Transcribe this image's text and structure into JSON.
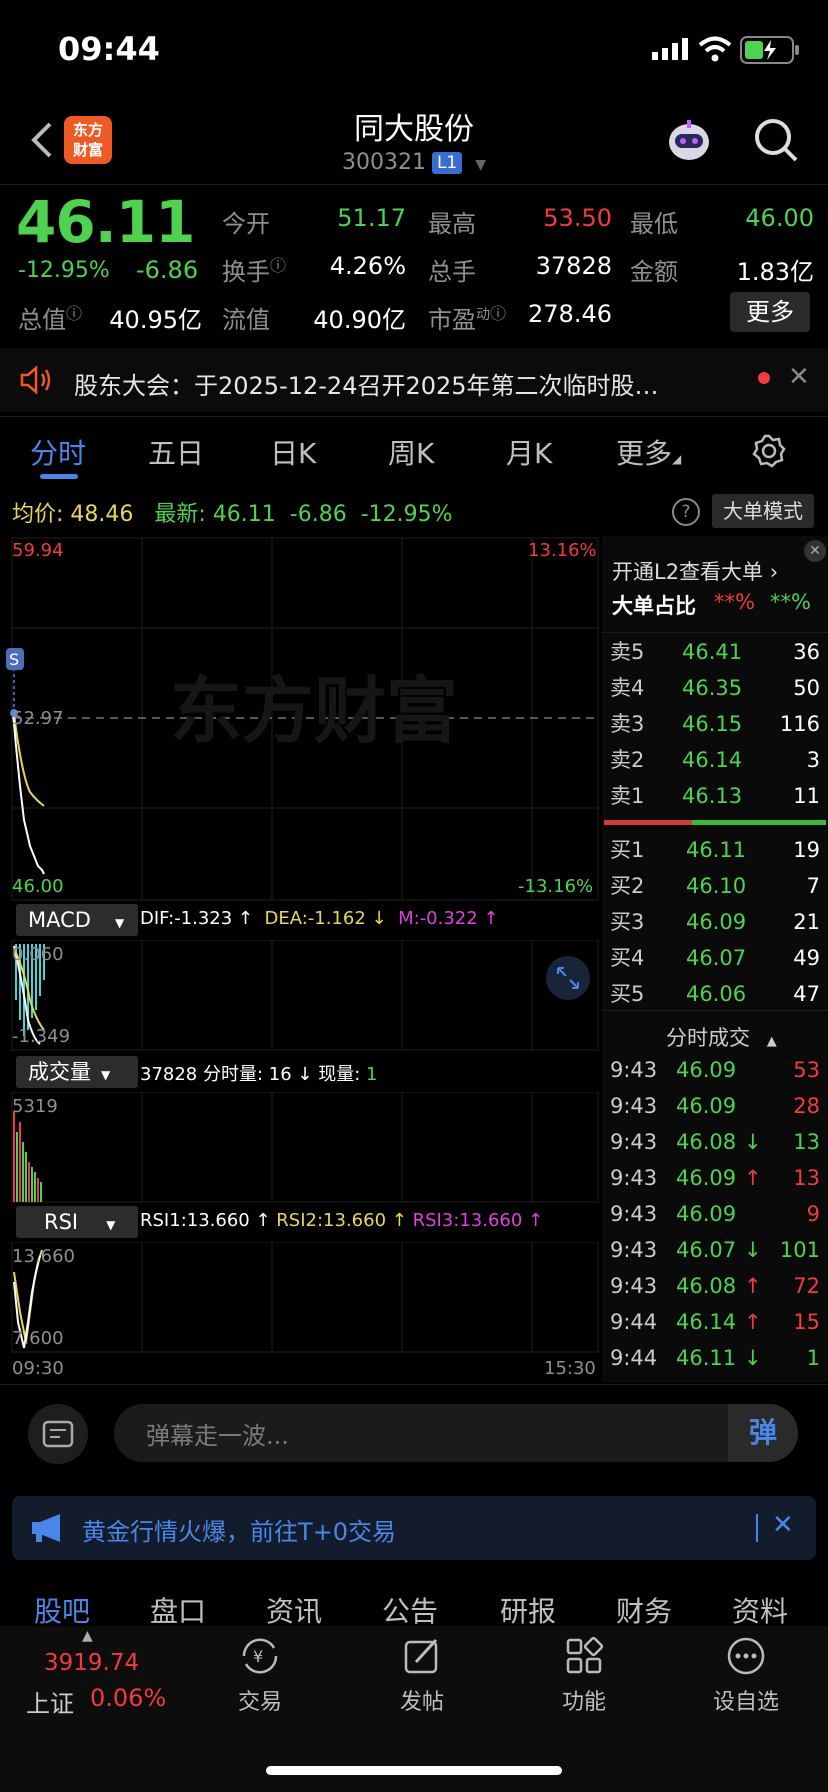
{
  "status": {
    "time": "09:44"
  },
  "header": {
    "title": "同大股份",
    "code": "300321",
    "level_badge": "L1",
    "logo_line1": "东方",
    "logo_line2": "财富"
  },
  "quote": {
    "price": "46.11",
    "change_pct": "-12.95%",
    "change": "-6.86",
    "open_label": "今开",
    "open": "51.17",
    "high_label": "最高",
    "high": "53.50",
    "low_label": "最低",
    "low": "46.00",
    "turnover_label": "换手",
    "turnover": "4.26%",
    "volume_label": "总手",
    "volume": "37828",
    "amount_label": "金额",
    "amount": "1.83亿",
    "mktcap_label": "总值",
    "mktcap": "40.95亿",
    "float_label": "流值",
    "float": "40.90亿",
    "pe_label": "市盈",
    "pe_sup": "动",
    "pe": "278.46",
    "more": "更多"
  },
  "notice": {
    "text": "股东大会：于2025-12-24召开2025年第二次临时股…"
  },
  "tabs": [
    "分时",
    "五日",
    "日K",
    "周K",
    "月K",
    "更多"
  ],
  "info_line": {
    "avg_label": "均价:",
    "avg": "48.46",
    "latest_label": "最新:",
    "latest": "46.11",
    "chg": "-6.86",
    "chg_pct": "-12.95%",
    "mode_btn": "大单模式"
  },
  "chart": {
    "y_top": "59.94",
    "y_mid": "52.97",
    "y_bot": "46.00",
    "pct_top": "13.16%",
    "pct_bot": "-13.16%",
    "watermark": "东方财富",
    "macd": {
      "label": "MACD",
      "dif": "DIF:-1.323 ↑",
      "dea": "DEA:-1.162 ↓",
      "m": "M:-0.322 ↑",
      "y_top": "0.060",
      "y_bot": "-1.349"
    },
    "vol": {
      "label": "成交量",
      "text": "37828 分时量: 16 ↓ 现量: ",
      "now": "1",
      "y_top": "5319"
    },
    "rsi": {
      "label": "RSI",
      "rsi1": "RSI1:13.660 ↑",
      "rsi2": "RSI2:13.660 ↑",
      "rsi3": "RSI3:13.660 ↑",
      "y_top": "13.660",
      "y_bot": "7.600"
    },
    "time_start": "09:30",
    "time_end": "15:30"
  },
  "panel": {
    "l2_text": "开通L2查看大单",
    "big_ratio_label": "大单占比",
    "big_red": "**%",
    "big_green": "**%",
    "asks": [
      {
        "label": "卖5",
        "price": "46.41",
        "vol": "36"
      },
      {
        "label": "卖4",
        "price": "46.35",
        "vol": "50"
      },
      {
        "label": "卖3",
        "price": "46.15",
        "vol": "116"
      },
      {
        "label": "卖2",
        "price": "46.14",
        "vol": "3"
      },
      {
        "label": "卖1",
        "price": "46.13",
        "vol": "11"
      }
    ],
    "bids": [
      {
        "label": "买1",
        "price": "46.11",
        "vol": "19"
      },
      {
        "label": "买2",
        "price": "46.10",
        "vol": "7"
      },
      {
        "label": "买3",
        "price": "46.09",
        "vol": "21"
      },
      {
        "label": "买4",
        "price": "46.07",
        "vol": "49"
      },
      {
        "label": "买5",
        "price": "46.06",
        "vol": "47"
      }
    ],
    "trades_title": "分时成交",
    "trades": [
      {
        "time": "9:43",
        "price": "46.09",
        "arrow": "",
        "vol": "53",
        "dir": "red"
      },
      {
        "time": "9:43",
        "price": "46.09",
        "arrow": "",
        "vol": "28",
        "dir": "red"
      },
      {
        "time": "9:43",
        "price": "46.08",
        "arrow": "↓",
        "vol": "13",
        "dir": "green"
      },
      {
        "time": "9:43",
        "price": "46.09",
        "arrow": "↑",
        "vol": "13",
        "dir": "red"
      },
      {
        "time": "9:43",
        "price": "46.09",
        "arrow": "",
        "vol": "9",
        "dir": "red"
      },
      {
        "time": "9:43",
        "price": "46.07",
        "arrow": "↓",
        "vol": "101",
        "dir": "green"
      },
      {
        "time": "9:43",
        "price": "46.08",
        "arrow": "↑",
        "vol": "72",
        "dir": "red"
      },
      {
        "time": "9:44",
        "price": "46.14",
        "arrow": "↑",
        "vol": "15",
        "dir": "red"
      },
      {
        "time": "9:44",
        "price": "46.11",
        "arrow": "↓",
        "vol": "1",
        "dir": "green"
      }
    ]
  },
  "danmu": {
    "placeholder": "弹幕走一波...",
    "btn": "弹"
  },
  "banner": {
    "text": "黄金行情火爆，前往T+0交易"
  },
  "bottom_tabs": [
    "股吧",
    "盘口",
    "资讯",
    "公告",
    "研报",
    "财务",
    "资料"
  ],
  "bottom_nav": {
    "index_value": "3919.74",
    "index_name": "上证",
    "index_pct": "0.06%",
    "items": [
      "交易",
      "发帖",
      "功能",
      "设自选"
    ]
  },
  "colors": {
    "up": "#f23b3b",
    "down": "#4fd24f",
    "accent": "#4a86e8",
    "avg": "#e8d75a"
  }
}
